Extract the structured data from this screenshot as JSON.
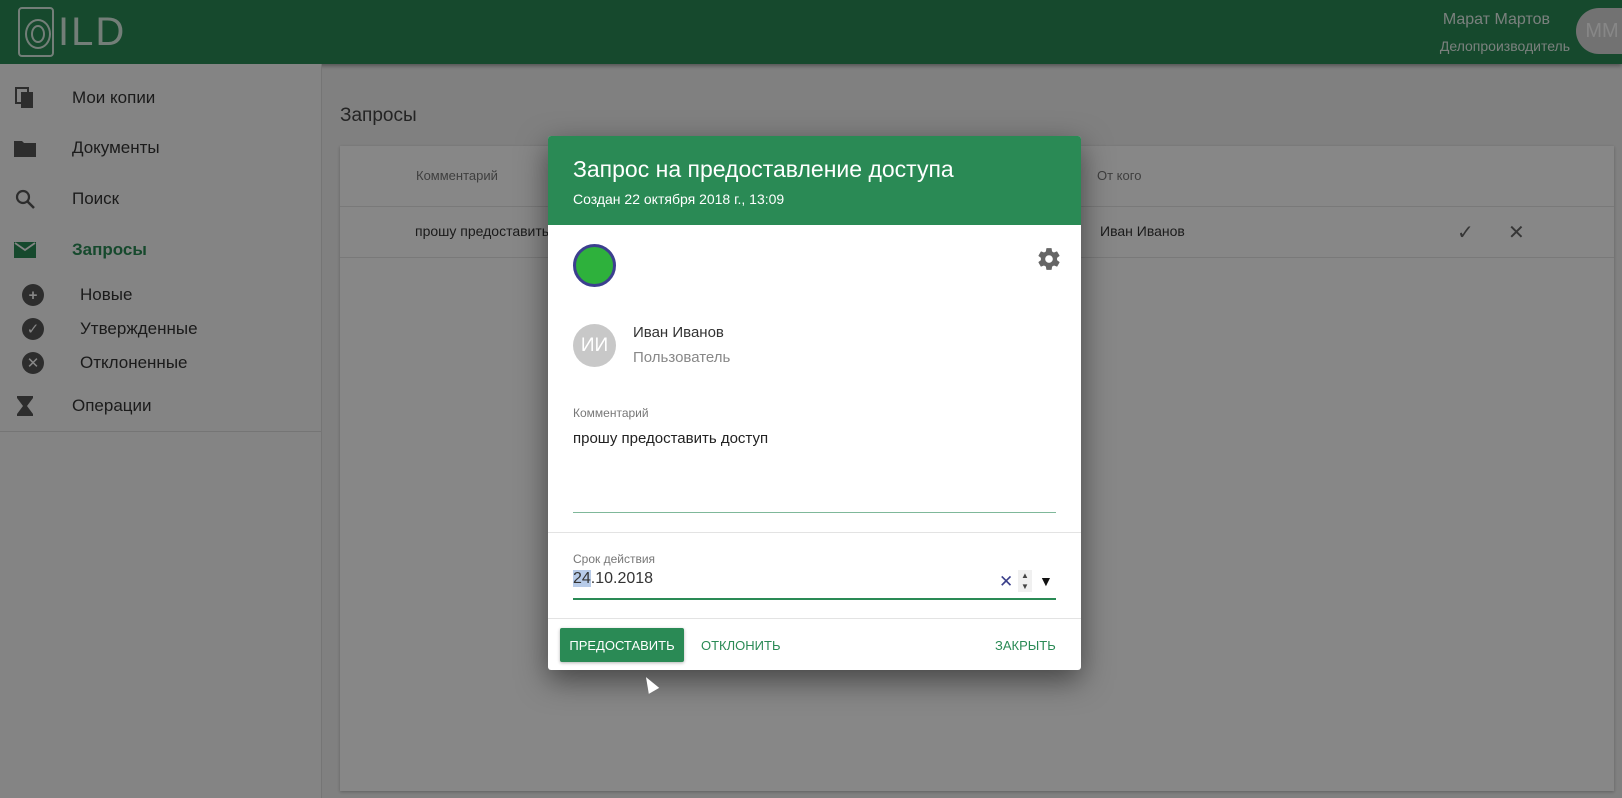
{
  "header": {
    "logo_text": "ILD",
    "user_name": "Марат Мартов",
    "user_role": "Делопроизводитель",
    "user_initials": "ММ"
  },
  "sidebar": {
    "items": [
      {
        "label": "Мои копии",
        "icon": "copy-icon"
      },
      {
        "label": "Документы",
        "icon": "folder-icon"
      },
      {
        "label": "Поиск",
        "icon": "search-icon"
      },
      {
        "label": "Запросы",
        "icon": "mail-icon"
      },
      {
        "label": "Операции",
        "icon": "hourglass-icon"
      }
    ],
    "subitems": [
      {
        "label": "Новые",
        "icon": "plus-icon",
        "glyph": "+"
      },
      {
        "label": "Утвержденные",
        "icon": "check-icon",
        "glyph": "✓"
      },
      {
        "label": "Отклоненные",
        "icon": "cross-icon",
        "glyph": "✕"
      }
    ]
  },
  "main": {
    "title": "Запросы",
    "columns": {
      "comment": "Комментарий",
      "from": "От кого"
    },
    "rows": [
      {
        "comment": "прошу предоставить",
        "from": "Иван Иванов"
      }
    ],
    "row_actions": {
      "approve": "✓",
      "reject": "✕"
    }
  },
  "dialog": {
    "title": "Запрос на предоставление доступа",
    "subtitle": "Создан 22 октября 2018 г., 13:09",
    "status_color": "#2eb13c",
    "person": {
      "initials": "ИИ",
      "name": "Иван Иванов",
      "role": "Пользователь"
    },
    "comment_label": "Комментарий",
    "comment_value": "прошу предоставить доступ",
    "validity_label": "Срок действия",
    "date_day": "24",
    "date_rest": ".10.2018",
    "buttons": {
      "grant": "ПРЕДОСТАВИТЬ",
      "reject": "ОТКЛОНИТЬ",
      "close": "ЗАКРЫТЬ"
    }
  },
  "colors": {
    "accent": "#2a8a55"
  }
}
